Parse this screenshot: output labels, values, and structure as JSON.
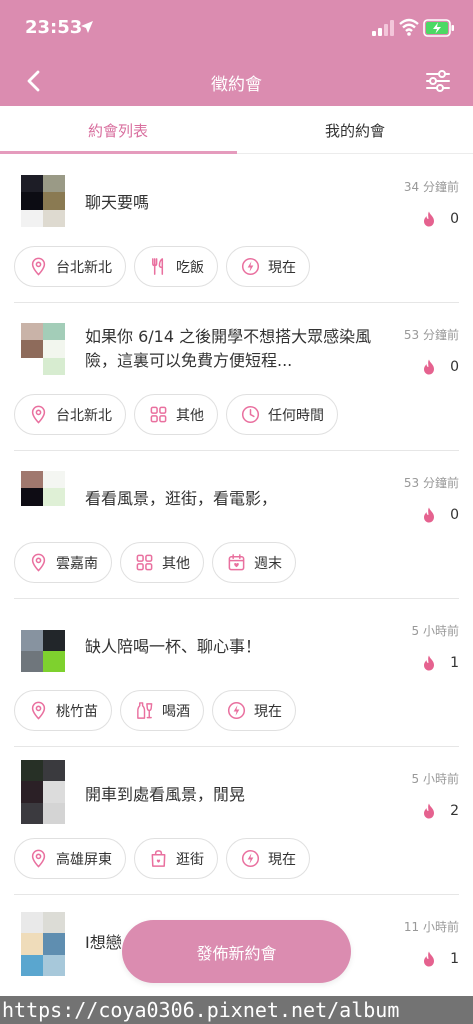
{
  "status_bar": {
    "time": "23:53"
  },
  "nav": {
    "title": "徵約會"
  },
  "tabs": [
    {
      "label": "約會列表",
      "active": true
    },
    {
      "label": "我的約會",
      "active": false
    }
  ],
  "posts": [
    {
      "title": "聊天要嗎",
      "time_ago": "34 分鐘前",
      "likes": "0",
      "tags": [
        {
          "icon": "location-pin-icon",
          "label": "台北新北"
        },
        {
          "icon": "utensils-icon",
          "label": "吃飯"
        },
        {
          "icon": "lightning-icon",
          "label": "現在"
        }
      ]
    },
    {
      "title": "如果你 6/14 之後開學不想搭大眾感染風險，這裏可以免費方便短程...",
      "time_ago": "53 分鐘前",
      "likes": "0",
      "tags": [
        {
          "icon": "location-pin-icon",
          "label": "台北新北"
        },
        {
          "icon": "grid-icon",
          "label": "其他"
        },
        {
          "icon": "clock-icon",
          "label": "任何時間"
        }
      ]
    },
    {
      "title": "看看風景，逛街，看電影，",
      "time_ago": "53 分鐘前",
      "likes": "0",
      "tags": [
        {
          "icon": "location-pin-icon",
          "label": "雲嘉南"
        },
        {
          "icon": "grid-icon",
          "label": "其他"
        },
        {
          "icon": "calendar-icon",
          "label": "週末"
        }
      ]
    },
    {
      "title": "缺人陪喝一杯、聊心事！",
      "time_ago": "5 小時前",
      "likes": "1",
      "tags": [
        {
          "icon": "location-pin-icon",
          "label": "桃竹苗"
        },
        {
          "icon": "wine-icon",
          "label": "喝酒"
        },
        {
          "icon": "lightning-icon",
          "label": "現在"
        }
      ]
    },
    {
      "title": "開車到處看風景，閒晃",
      "time_ago": "5 小時前",
      "likes": "2",
      "tags": [
        {
          "icon": "location-pin-icon",
          "label": "高雄屏東"
        },
        {
          "icon": "shopping-bag-icon",
          "label": "逛街"
        },
        {
          "icon": "lightning-icon",
          "label": "現在"
        }
      ]
    },
    {
      "title": "I想戀",
      "time_ago": "11 小時前",
      "likes": "1",
      "tags": []
    }
  ],
  "fab": {
    "label": "發佈新約會"
  },
  "watermark": {
    "text": "https://coya0306.pixnet.net/album"
  },
  "colors": {
    "brand": "#db8cb0",
    "accent": "#d9709f",
    "flame": "#e5628f"
  }
}
